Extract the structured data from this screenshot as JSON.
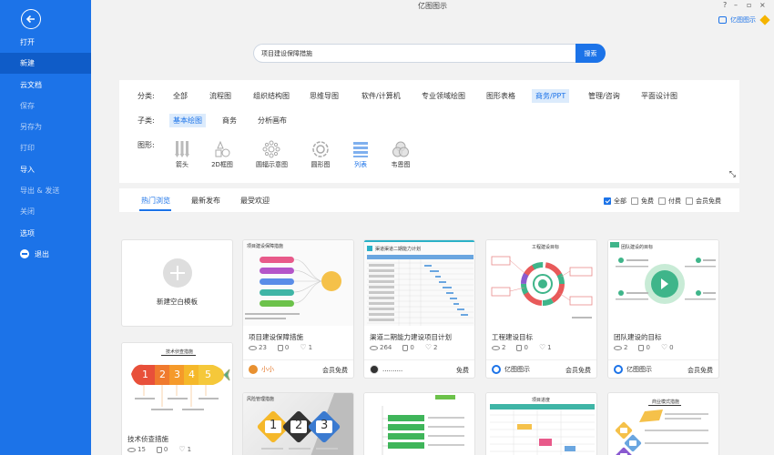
{
  "window": {
    "title": "亿图图示",
    "account_name": "亿图图示",
    "controls": {
      "help": "?",
      "minimize": "–",
      "restore": "▫",
      "close": "×"
    }
  },
  "sidebar": {
    "items": [
      {
        "label": "打开"
      },
      {
        "label": "新建"
      },
      {
        "label": "云文档"
      },
      {
        "label": "保存"
      },
      {
        "label": "另存为"
      },
      {
        "label": "打印"
      },
      {
        "label": "导入"
      },
      {
        "label": "导出 & 发送"
      },
      {
        "label": "关闭"
      },
      {
        "label": "选项"
      },
      {
        "label": "退出"
      }
    ]
  },
  "search": {
    "value": "项目建设保障措施",
    "button": "搜索"
  },
  "filters": {
    "category_label": "分类:",
    "categories": [
      "全部",
      "流程图",
      "组织结构图",
      "思维导图",
      "软件/计算机",
      "专业领域绘图",
      "图形表格",
      "商务/PPT",
      "管理/咨询",
      "平面设计图"
    ],
    "subtype_label": "子类:",
    "subtypes": [
      "基本绘图",
      "商务",
      "分析画布"
    ],
    "shape_label": "图形:",
    "shapes": [
      "箭头",
      "2D框图",
      "圆辐示意图",
      "圆形图",
      "列表",
      "韦恩图"
    ]
  },
  "sortbar": {
    "tabs": [
      "热门浏览",
      "最新发布",
      "最受欢迎"
    ],
    "checks": [
      "全部",
      "免费",
      "付费",
      "会员免费"
    ]
  },
  "cards": {
    "new_template": "新建空白模板",
    "items": [
      {
        "title": "项目建设保障措施",
        "views": "23",
        "likes": "0",
        "favs": "1",
        "author": "小小",
        "price": "会员免费",
        "thumb_title": "项目建设保障措施"
      },
      {
        "title": "渠道二期能力建设项目计划",
        "views": "264",
        "likes": "0",
        "favs": "2",
        "author": "..........",
        "price": "免费",
        "thumb_title": "渠道渠道二期能力计划"
      },
      {
        "title": "工程建设目标",
        "views": "2",
        "likes": "0",
        "favs": "1",
        "author": "亿图图示",
        "price": "会员免费",
        "thumb_title": "工程建设目标"
      },
      {
        "title": "团队建设的目标",
        "views": "2",
        "likes": "0",
        "favs": "0",
        "author": "亿图图示",
        "price": "会员免费",
        "thumb_title": "团队建设的目标"
      },
      {
        "title": "技术侦查措施",
        "views": "15",
        "likes": "0",
        "favs": "1",
        "thumb_title": "技术侦查措施",
        "numbers": [
          "1",
          "2",
          "3",
          "4",
          "5"
        ]
      },
      {
        "thumb_title": "风险管理措施",
        "numbers": [
          "1",
          "2",
          "3"
        ]
      },
      {
        "thumb_title": ""
      },
      {
        "thumb_title": "项目进度"
      },
      {
        "thumb_title": "商业模式措施"
      }
    ]
  },
  "colors": {
    "accent": "#1c73e8",
    "sidebar": "#1c73e8",
    "sidebar_active": "#0f5cc8"
  }
}
